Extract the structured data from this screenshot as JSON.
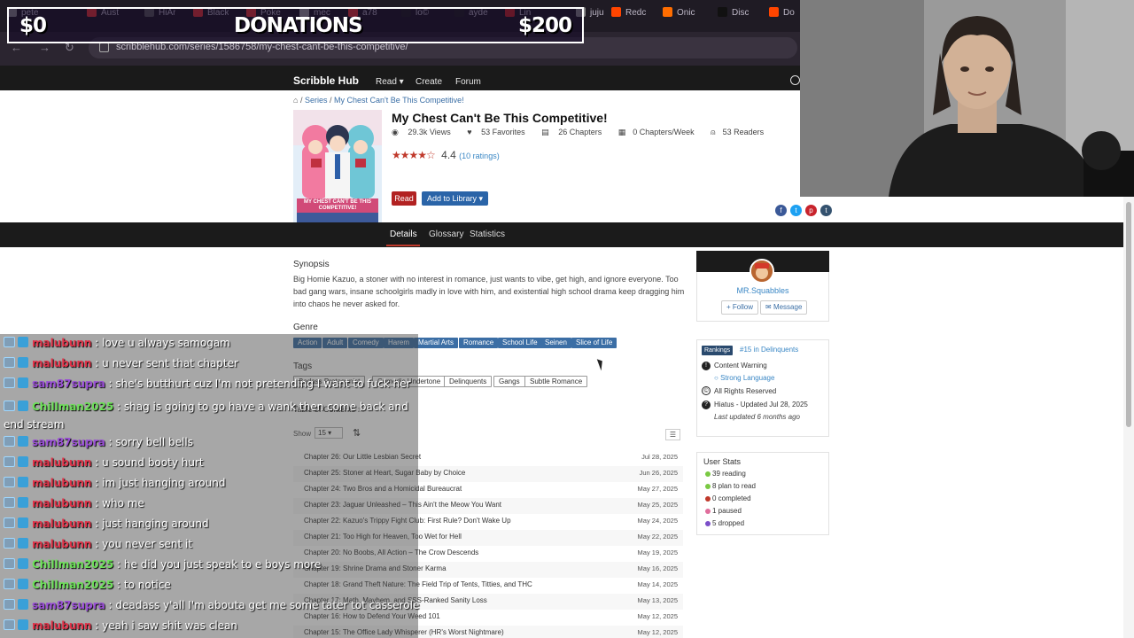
{
  "browser": {
    "tabs": [
      {
        "label": "pete",
        "color": "#888888"
      },
      {
        "label": "Aust",
        "color": "#e53935"
      },
      {
        "label": "HiAr",
        "color": "#5a5a5a"
      },
      {
        "label": "Black",
        "color": "#e53935"
      },
      {
        "label": "Poke",
        "color": "#e53935"
      },
      {
        "label": "mec",
        "color": "#9e9e9e"
      },
      {
        "label": "a78",
        "color": "#e53935"
      },
      {
        "label": "lo©",
        "color": "#222222"
      },
      {
        "label": "ayde",
        "color": "#222222"
      },
      {
        "label": "Lin",
        "color": "#c62828"
      },
      {
        "label": "juju",
        "color": "#888888"
      },
      {
        "label": "Redc",
        "color": "#ff4500"
      },
      {
        "label": "Onic",
        "color": "#ff6d00"
      },
      {
        "label": "Disc",
        "color": "#111111"
      },
      {
        "label": "Do",
        "color": "#ff4500"
      }
    ],
    "url": "scribblehub.com/series/1586758/my-chest-cant-be-this-competitive/"
  },
  "donations": {
    "left": "$0",
    "title": "DONATIONS",
    "right": "$200",
    "progress": 0.0
  },
  "site": {
    "brand": "Scribble Hub",
    "nav": [
      "Read ▾",
      "Create",
      "Forum"
    ]
  },
  "series": {
    "breadcrumb_sep": " / ",
    "breadcrumb_series": "Series",
    "breadcrumb_title": "My Chest Can't Be This Competitive!",
    "title": "My Chest Can't Be This Competitive!",
    "views": "29.3k Views",
    "favorites": "53 Favorites",
    "chapters": "26 Chapters",
    "per_week": "0 Chapters/Week",
    "readers": "53 Readers",
    "stars": "★★★★☆",
    "rating": "4.4",
    "rating_count": "(10 ratings)",
    "read_btn": "Read",
    "library_btn": "Add to Library ▾",
    "cover_text": "MY CHEST CAN'T BE THIS COMPETITIVE!"
  },
  "detail_tabs": [
    "Details",
    "Glossary",
    "Statistics"
  ],
  "synopsis": {
    "heading": "Synopsis",
    "text": "Big Homie Kazuo, a stoner with no interest in romance, just wants to vibe, get high, and ignore everyone. Too bad gang wars, insane schoolgirls madly in love with him, and existential high school drama keep dragging him into chaos he never asked for."
  },
  "genre": {
    "heading": "Genre",
    "items": [
      "Action",
      "Adult",
      "Comedy",
      "Harem",
      "Martial Arts",
      "Romance",
      "School Life",
      "Seinen",
      "Slice of Life"
    ]
  },
  "tags": {
    "heading": "Tags",
    "items": [
      "Badass Protagonist",
      "Comedic Undertone",
      "Delinquents",
      "Gangs",
      "Subtle Romance"
    ]
  },
  "toc": {
    "heading": "Table of Contents",
    "count": "26",
    "show_label": "Show",
    "show_value": "15 ▾",
    "chapters": [
      {
        "title": "Chapter 26: Our Little Lesbian Secret",
        "date": "Jul 28, 2025"
      },
      {
        "title": "Chapter 25: Stoner at Heart, Sugar Baby by Choice",
        "date": "Jun 26, 2025"
      },
      {
        "title": "Chapter 24: Two Bros and a Homicidal Bureaucrat",
        "date": "May 27, 2025"
      },
      {
        "title": "Chapter 23: Jaguar Unleashed – This Ain't the Meow You Want",
        "date": "May 25, 2025"
      },
      {
        "title": "Chapter 22: Kazuo's Trippy Fight Club: First Rule? Don't Wake Up",
        "date": "May 24, 2025"
      },
      {
        "title": "Chapter 21: Too High for Heaven, Too Wet for Hell",
        "date": "May 22, 2025"
      },
      {
        "title": "Chapter 20: No Boobs, All Action – The Crow Descends",
        "date": "May 19, 2025"
      },
      {
        "title": "Chapter 19: Shrine Drama and Stoner Karma",
        "date": "May 16, 2025"
      },
      {
        "title": "Chapter 18: Grand Theft Nature: The Field Trip of Tents, Titties, and THC",
        "date": "May 14, 2025"
      },
      {
        "title": "Chapter 17: Math, Mayhem, and SSS-Ranked Sanity Loss",
        "date": "May 13, 2025"
      },
      {
        "title": "Chapter 16: How to Defend Your Weed 101",
        "date": "May 12, 2025"
      },
      {
        "title": "Chapter 15: The Office Lady Whisperer (HR's Worst Nightmare)",
        "date": "May 12, 2025"
      }
    ]
  },
  "author": {
    "name": "MR.Squabbles",
    "follow": "Follow",
    "message": "Message"
  },
  "info": {
    "rank_badge": "Rankings",
    "rank_text": "#15 in Delinquents",
    "content_warning": "Content Warning",
    "warning_item": "Strong Language",
    "rights": "All Rights Reserved",
    "status": "Hiatus - Updated Jul 28, 2025",
    "last_updated": "Last updated 6 months ago"
  },
  "user_stats": {
    "heading": "User Stats",
    "items": [
      {
        "label": "39 reading",
        "color": "#7ac943"
      },
      {
        "label": "8 plan to read",
        "color": "#7ac943"
      },
      {
        "label": "0 completed",
        "color": "#c0392b"
      },
      {
        "label": "1 paused",
        "color": "#e06e9c"
      },
      {
        "label": "5 dropped",
        "color": "#7b4fc9"
      }
    ]
  },
  "chat": [
    {
      "user": "malubunn",
      "color": "#e0344a",
      "text": " : love u always samogam"
    },
    {
      "user": "malubunn",
      "color": "#e0344a",
      "text": " : u never sent that chapter"
    },
    {
      "user": "sam87supra",
      "color": "#9a4fd6",
      "text": " : she's butthurt cuz I'm not pretending I want to fuck her"
    },
    {
      "user": "Chillman2025",
      "color": "#6ee05a",
      "text": " : shag is going to go have a wank then come back and end stream"
    },
    {
      "user": "sam87supra",
      "color": "#9a4fd6",
      "text": " : sorry bell bells"
    },
    {
      "user": "malubunn",
      "color": "#e0344a",
      "text": " : u sound booty hurt"
    },
    {
      "user": "malubunn",
      "color": "#e0344a",
      "text": " : im just hanging around"
    },
    {
      "user": "malubunn",
      "color": "#e0344a",
      "text": " : who me"
    },
    {
      "user": "malubunn",
      "color": "#e0344a",
      "text": " : just hanging around"
    },
    {
      "user": "malubunn",
      "color": "#e0344a",
      "text": " : you never sent it"
    },
    {
      "user": "Chillman2025",
      "color": "#6ee05a",
      "text": " : he did you just speak to e boys more"
    },
    {
      "user": "Chillman2025",
      "color": "#6ee05a",
      "text": " : to notice"
    },
    {
      "user": "sam87supra",
      "color": "#9a4fd6",
      "text": " : deadass y'all I'm abouta get me some tater tot casserole"
    },
    {
      "user": "malubunn",
      "color": "#e0344a",
      "text": " : yeah i saw shit was clean"
    }
  ]
}
